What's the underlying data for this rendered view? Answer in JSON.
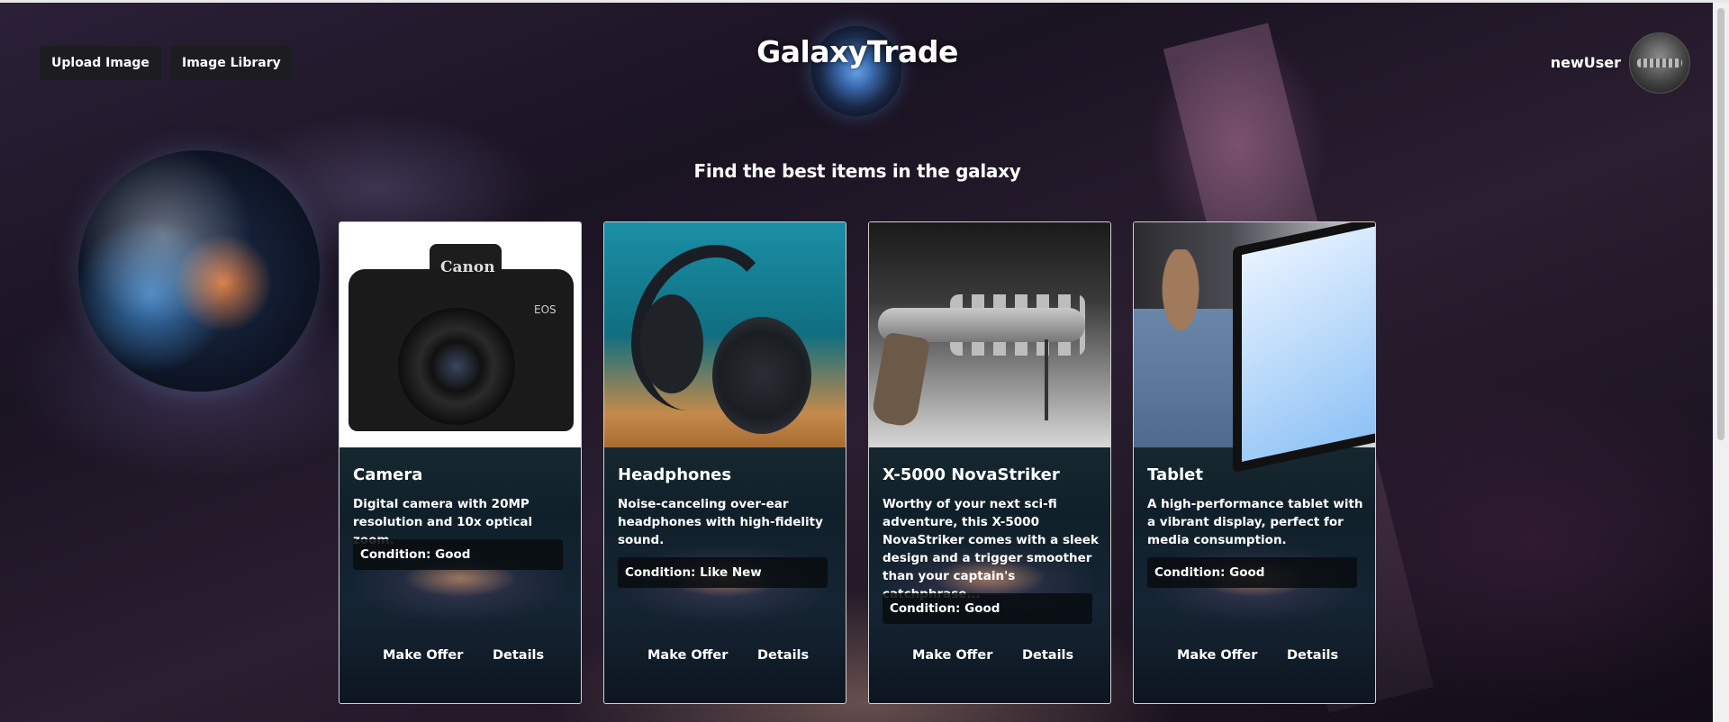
{
  "header": {
    "upload_label": "Upload Image",
    "library_label": "Image Library",
    "logo_text": "GalaxyTrade",
    "username": "newUser"
  },
  "tagline": "Find the best items in the galaxy",
  "products": [
    {
      "name": "Camera",
      "description": "Digital camera with 20MP resolution and 10x optical zoom.",
      "condition": "Condition: Good",
      "make_offer": "Make Offer",
      "details": "Details",
      "image_icon": "camera-image"
    },
    {
      "name": "Headphones",
      "description": "Noise-canceling over-ear headphones with high-fidelity sound.",
      "condition": "Condition: Like New",
      "make_offer": "Make Offer",
      "details": "Details",
      "image_icon": "headphones-image"
    },
    {
      "name": "X-5000 NovaStriker",
      "description": "Worthy of your next sci-fi adventure, this X-5000 NovaStriker comes with a sleek design and a trigger smoother than your captain's catchphrase...",
      "condition": "Condition: Good",
      "make_offer": "Make Offer",
      "details": "Details",
      "image_icon": "blaster-image"
    },
    {
      "name": "Tablet",
      "description": "A high-performance tablet with a vibrant display, perfect for media consumption.",
      "condition": "Condition: Good",
      "make_offer": "Make Offer",
      "details": "Details",
      "image_icon": "tablet-image"
    }
  ],
  "camera_image": {
    "brand": "Canon",
    "model": "EOS"
  },
  "colors": {
    "button_bg": "#1d1d21",
    "card_border": "#cfcfcf",
    "condition_bg": "#080c10"
  }
}
